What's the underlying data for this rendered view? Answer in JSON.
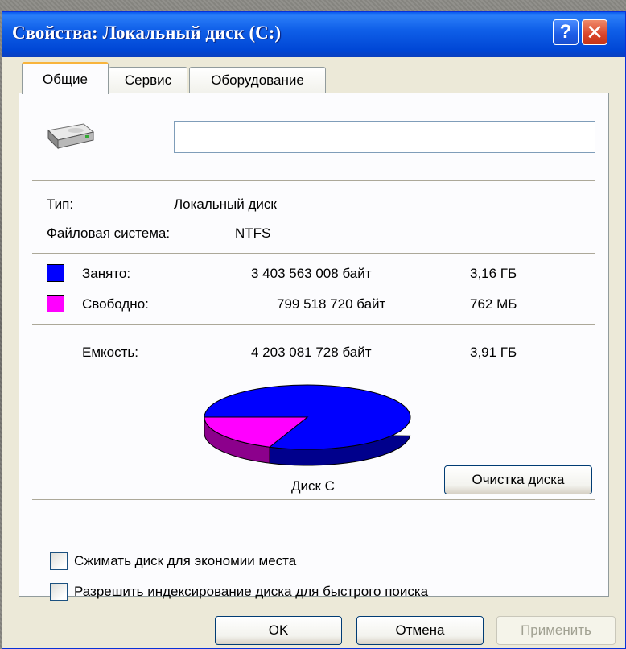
{
  "window": {
    "title": "Свойства: Локальный диск (C:)",
    "help_label": "?",
    "close_label": "✕"
  },
  "tabs": [
    {
      "label": "Общие",
      "active": true
    },
    {
      "label": "Сервис",
      "active": false
    },
    {
      "label": "Оборудование",
      "active": false
    }
  ],
  "general": {
    "disk_label_value": "",
    "type_label": "Тип:",
    "type_value": "Локальный диск",
    "fs_label": "Файловая система:",
    "fs_value": "NTFS",
    "used": {
      "label": "Занято:",
      "bytes": "3 403 563 008 байт",
      "size": "3,16 ГБ",
      "color": "#0000ff"
    },
    "free": {
      "label": "Свободно:",
      "bytes": "799 518 720 байт",
      "size": "762 МБ",
      "color": "#ff00ff"
    },
    "capacity": {
      "label": "Емкость:",
      "bytes": "4 203 081 728 байт",
      "size": "3,91 ГБ"
    },
    "disk_caption": "Диск C",
    "cleanup_label": "Очистка диска",
    "compress_label": "Сжимать диск для экономии места",
    "compress_checked": false,
    "index_label": "Разрешить индексирование диска для быстрого поиска",
    "index_checked": false
  },
  "chart_data": {
    "type": "pie",
    "title": "",
    "labels": [
      "Занято",
      "Свободно"
    ],
    "values": [
      3403563008,
      799518720
    ],
    "colors": [
      "#0000ff",
      "#ff00ff"
    ]
  },
  "buttons": {
    "ok_label": "OK",
    "cancel_label": "Отмена",
    "apply_label": "Применить"
  }
}
